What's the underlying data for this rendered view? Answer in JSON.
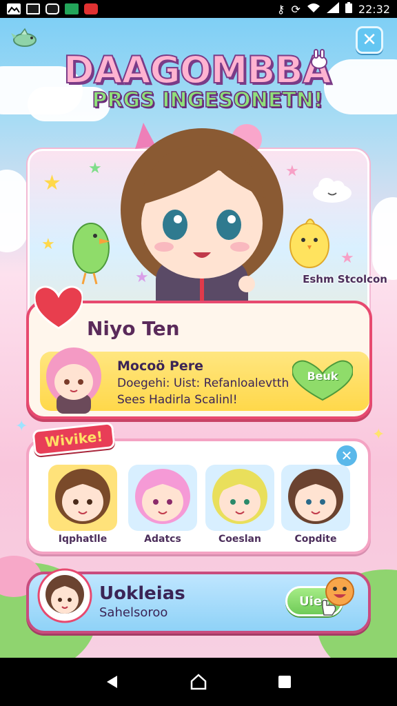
{
  "status_bar": {
    "time": "22:32",
    "left_icons": [
      "gallery-icon",
      "image-icon",
      "instagram-icon",
      "download-icon",
      "shield-icon"
    ],
    "right_icons": [
      "key-icon",
      "sync-icon",
      "wifi-icon",
      "signal-icon",
      "battery-icon"
    ]
  },
  "game": {
    "logo_title": "DAAGOMBBA",
    "logo_subtitle": "PRGS INGESONETN!",
    "hero_caption": "Eshm Stcolcon",
    "profile": {
      "title": "Niyo Ten",
      "line1": "Mocoö Pere",
      "line2": "Doegehi: Uist: Refanloalevtth",
      "line3": "Sees Hadirla Scalinl!",
      "action_label": "Beuk"
    },
    "roster": {
      "tag": "Wivike!",
      "characters": [
        {
          "label": "Iqphatlle",
          "hair": "#7a4a2a",
          "frame": "#ffe27a"
        },
        {
          "label": "Adatcs",
          "hair": "#f59ad6",
          "frame": "#d8efff"
        },
        {
          "label": "Coeslan",
          "hair": "#e9df5b",
          "frame": "#d8efff"
        },
        {
          "label": "Copdite",
          "hair": "#6b4330",
          "frame": "#d8efff"
        }
      ]
    },
    "bottom": {
      "title": "Uokleias",
      "subtitle": "Sahelsoroo",
      "button_label": "Uies"
    }
  },
  "colors": {
    "accent_pink": "#e7496f",
    "accent_blue": "#64c6f2",
    "accent_green": "#6fcb58",
    "accent_yellow": "#ffd84a"
  }
}
